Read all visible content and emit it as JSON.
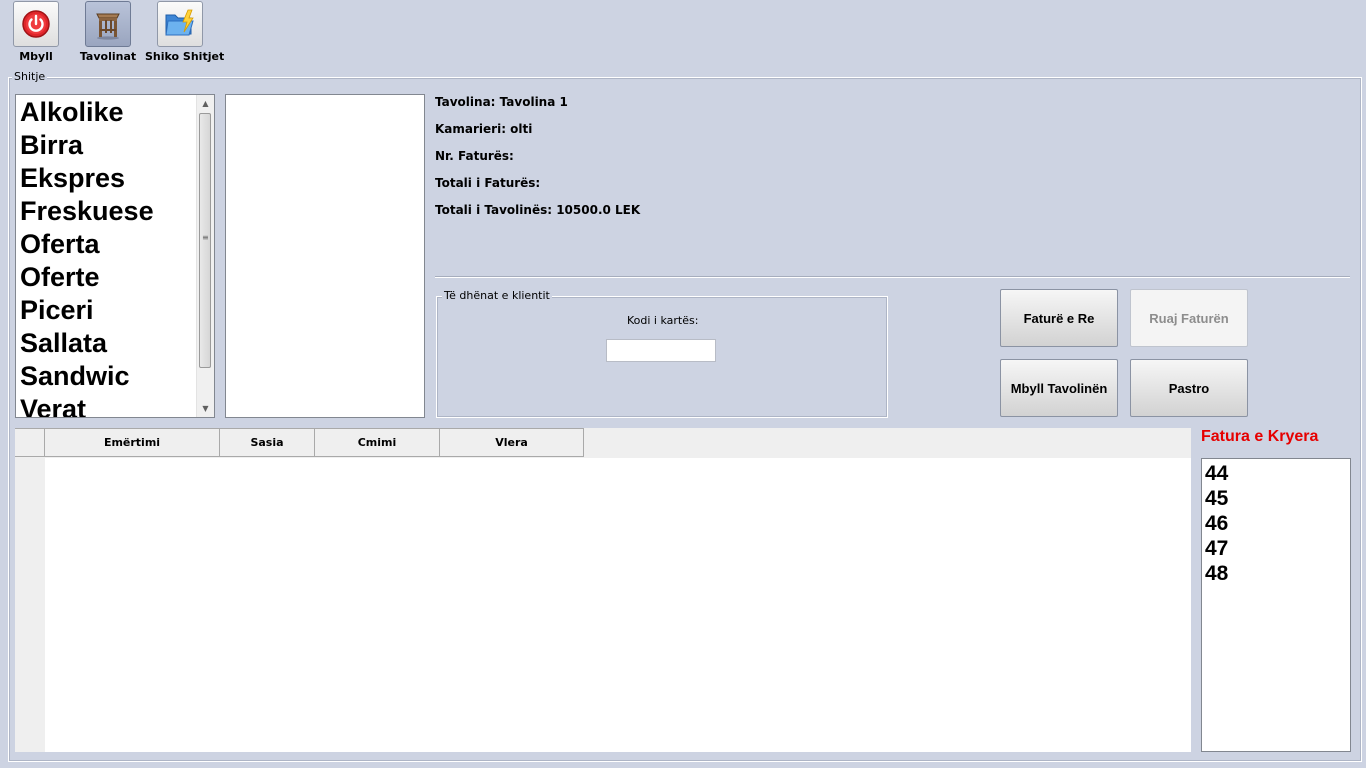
{
  "toolbar": {
    "close_label": "Mbyll",
    "tables_label": "Tavolinat",
    "sales_label": "Shiko Shitjet"
  },
  "sales_group": {
    "title": "Shitje"
  },
  "categories": [
    "Alkolike",
    "Birra",
    "Ekspres",
    "Freskuese",
    "Oferta",
    "Oferte",
    "Piceri",
    "Sallata",
    "Sandwic",
    "Verat"
  ],
  "info": {
    "table": "Tavolina: Tavolina 1",
    "waiter": "Kamarieri: olti",
    "invoice_no": "Nr. Faturës:",
    "invoice_total": "Totali i Faturës:",
    "table_total": "Totali i Tavolinës: 10500.0 LEK"
  },
  "client": {
    "title": "Të dhënat e klientit",
    "card_label": "Kodi i kartës:",
    "card_value": ""
  },
  "buttons": {
    "new_invoice": "Faturë e Re",
    "save_invoice": "Ruaj Faturën",
    "close_table": "Mbyll Tavolinën",
    "clear": "Pastro"
  },
  "grid": {
    "columns": [
      "Emërtimi",
      "Sasia",
      "Cmimi",
      "Vlera"
    ]
  },
  "completed": {
    "title": "Fatura e Kryera",
    "items": [
      "44",
      "45",
      "46",
      "47",
      "48"
    ]
  },
  "colors": {
    "accent_red": "#e60000",
    "background": "#cdd3e2"
  }
}
